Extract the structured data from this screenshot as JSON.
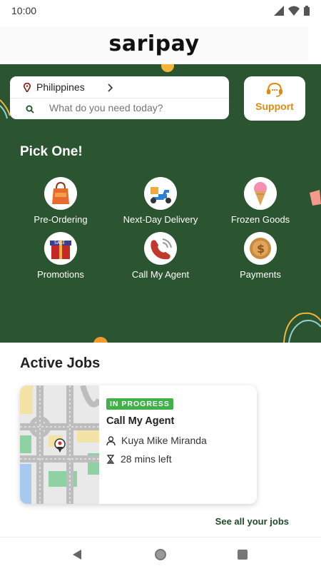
{
  "status_bar": {
    "time": "10:00"
  },
  "header": {
    "logo": "saripay"
  },
  "location": {
    "label": "Philippines"
  },
  "search": {
    "placeholder": "What do you need today?"
  },
  "support": {
    "label": "Support"
  },
  "pick": {
    "title": "Pick One!",
    "categories": [
      {
        "label": "Pre-Ordering",
        "icon": "shopping-bag-icon"
      },
      {
        "label": "Next-Day Delivery",
        "icon": "scooter-icon"
      },
      {
        "label": "Frozen Goods",
        "icon": "ice-cream-icon"
      },
      {
        "label": "Promotions",
        "icon": "gift-box-icon"
      },
      {
        "label": "Call My Agent",
        "icon": "phone-icon"
      },
      {
        "label": "Payments",
        "icon": "coin-icon"
      }
    ]
  },
  "active_jobs": {
    "title": "Active Jobs",
    "job": {
      "status": "IN PROGRESS",
      "title": "Call My Agent",
      "agent": "Kuya Mike Miranda",
      "time_left": "28 mins left"
    },
    "see_all": "See all your jobs"
  },
  "colors": {
    "brand_green": "#2a5530",
    "accent_orange": "#e08a12",
    "status_green": "#42b04b"
  }
}
